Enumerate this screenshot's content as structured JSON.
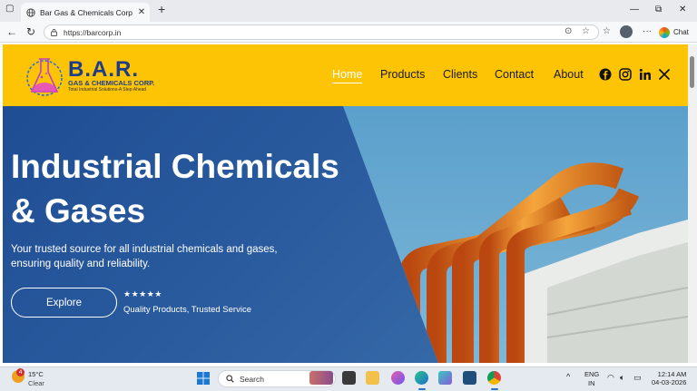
{
  "browser": {
    "tab_title": "Bar Gas & Chemicals Corp - Indus",
    "url": "https://barcorp.in",
    "chat_label": "Chat"
  },
  "site": {
    "brand_name": "B.A.R.",
    "brand_subtitle": "GAS & CHEMICALS CORP.",
    "brand_tagline": "Total Industrial Solutions-A Step Ahead",
    "nav": [
      "Home",
      "Products",
      "Clients",
      "Contact",
      "About"
    ],
    "hero": {
      "title_line1": "Industrial Chemicals",
      "title_line2": "& Gases",
      "subtitle_line1": "Your trusted source for all industrial chemicals and gases,",
      "subtitle_line2": "ensuring quality and reliability.",
      "cta_label": "Explore",
      "rating_stars": "★★★★★",
      "rating_caption": "Quality Products, Trusted Service"
    },
    "colors": {
      "header": "#fcc404",
      "brand": "#1f3c8a",
      "hero": "#2b5c9f"
    }
  },
  "taskbar": {
    "weather_badge": "4",
    "temperature": "15°C",
    "condition": "Clear",
    "search_label": "Search",
    "lang_line1": "ENG",
    "lang_line2": "IN",
    "time": "12:14 AM",
    "date": "04-03-2026"
  }
}
